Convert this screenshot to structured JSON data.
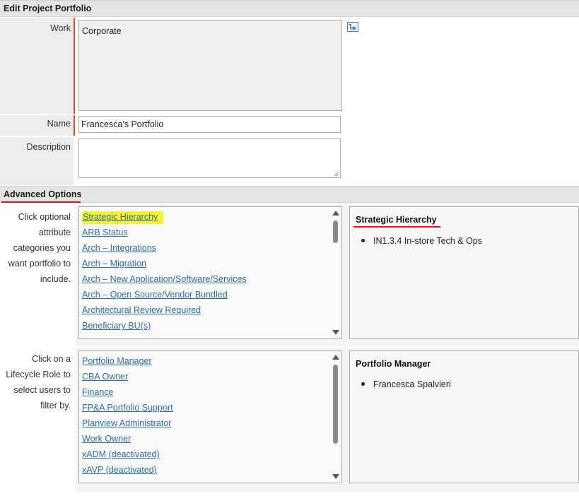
{
  "header": {
    "title": "Edit Project Portfolio"
  },
  "form": {
    "work_label": "Work",
    "work_value": "Corporate",
    "name_label": "Name",
    "name_value": "Francesca's Portfolio",
    "description_label": "Description",
    "description_value": ""
  },
  "advanced": {
    "title": "Advanced Options",
    "attr_instructions": [
      "Click optional",
      "attribute",
      "categories you",
      "want portfolio to",
      "include."
    ],
    "attr_items": [
      "Strategic Hierarchy",
      "ARB Status",
      "Arch – Integrations",
      "Arch – Migration",
      "Arch – New Application/Software/Services",
      "Arch – Open Source/Vendor Bundled",
      "Architectural Review Required",
      "Beneficiary BU(s)"
    ],
    "attr_detail": {
      "title": "Strategic Hierarchy",
      "bullets": [
        "IN1.3.4 In-store Tech & Ops"
      ]
    },
    "role_instructions": [
      "Click on a",
      "Lifecycle Role to",
      "select users to",
      "filter by."
    ],
    "role_items": [
      "Portfolio Manager",
      "CBA Owner",
      "Finance",
      "FP&A Portfolio Support",
      "Planview Administrator",
      "Work Owner",
      "xADM (deactivated)",
      "xAVP (deactivated)"
    ],
    "role_detail": {
      "title": "Portfolio Manager",
      "bullets": [
        "Francesca Spalvieri"
      ]
    }
  },
  "colors": {
    "annotation_red": "#e0141a",
    "highlight_yellow": "#f6f32a",
    "link_blue": "#2b6cb0",
    "required_bar": "#d9462a"
  },
  "icons": {
    "work_picker": "hierarchy-picker-icon"
  }
}
